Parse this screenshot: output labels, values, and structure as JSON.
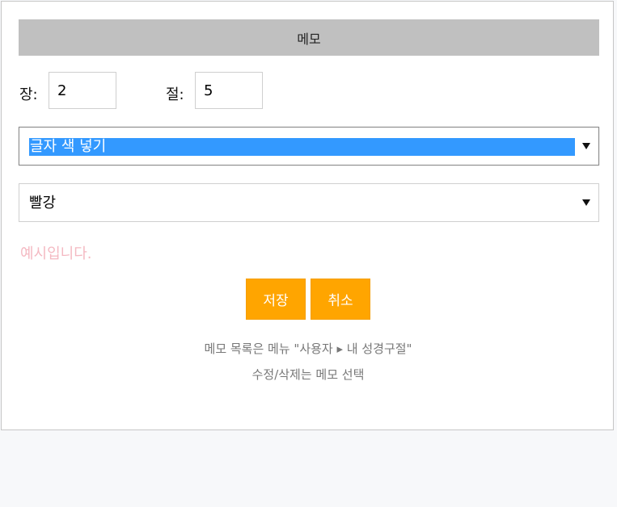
{
  "dialog": {
    "title": "메모",
    "chapter_label": "장:",
    "chapter_value": "2",
    "verse_label": "절:",
    "verse_value": "5",
    "style_select": {
      "selected": "글자 색 넣기"
    },
    "color_select": {
      "selected": "빨강"
    },
    "preview_text": "예시입니다.",
    "preview_color": "#f4b9c2",
    "buttons": {
      "save": "저장",
      "cancel": "취소"
    },
    "button_color": "#ffa500",
    "help_line1": "메모 목록은 메뉴 \"사용자 ▸ 내 성경구절\"",
    "help_line2": "수정/삭제는 메모 선택"
  }
}
